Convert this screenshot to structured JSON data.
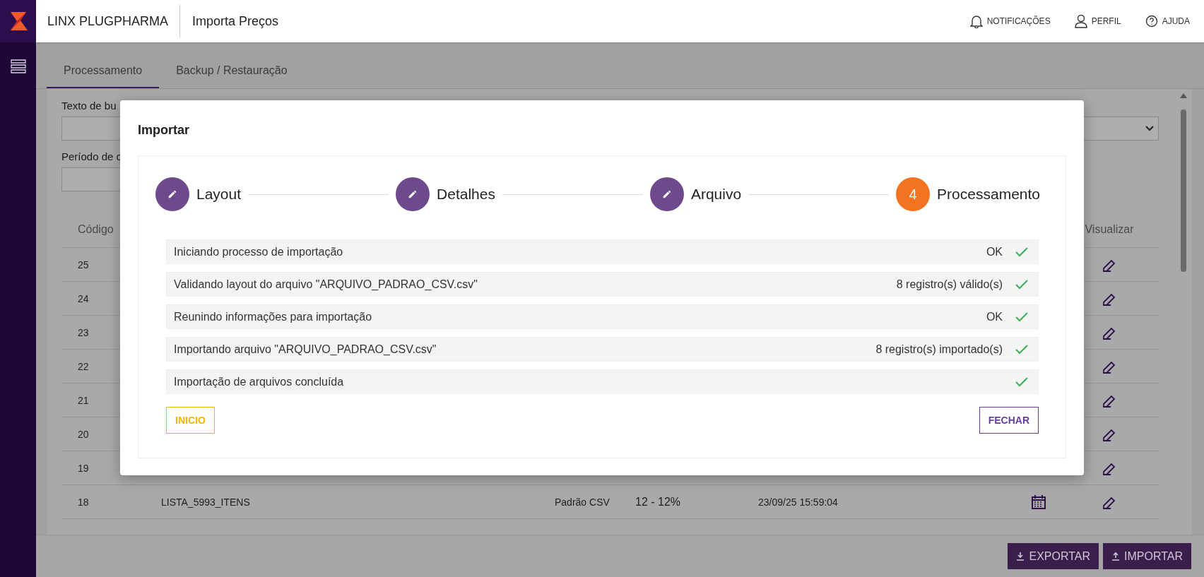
{
  "app": {
    "brand": "LINX PLUGPHARMA",
    "page_title": "Importa Preços"
  },
  "top_actions": [
    {
      "label": "NOTIFICAÇÕES",
      "kind": "bell"
    },
    {
      "label": "PERFIL",
      "kind": "user"
    },
    {
      "label": "AJUDA",
      "kind": "help"
    }
  ],
  "tabs": [
    {
      "label": "Processamento",
      "selected": true
    },
    {
      "label": "Backup / Restauração",
      "selected": false
    }
  ],
  "filters": {
    "search_label": "Texto de bu",
    "period_label": "Período de c"
  },
  "table": {
    "columns": {
      "code": "Código",
      "view": "Visualizar"
    },
    "rows": [
      {
        "code": "25"
      },
      {
        "code": "24"
      },
      {
        "code": "23"
      },
      {
        "code": "22"
      },
      {
        "code": "21"
      },
      {
        "code": "20"
      },
      {
        "code": "19"
      },
      {
        "code": "18",
        "name": "LISTA_5993_ITENS",
        "layout": "Padrão CSV",
        "percent": "12 - 12%",
        "date": "23/09/25 15:59:04"
      }
    ]
  },
  "footer_buttons": [
    {
      "label": "EXPORTAR",
      "kind": "export"
    },
    {
      "label": "IMPORTAR",
      "kind": "import"
    }
  ],
  "modal": {
    "title": "Importar",
    "steps": [
      {
        "label": "Layout",
        "done": true
      },
      {
        "label": "Detalhes",
        "done": true
      },
      {
        "label": "Arquivo",
        "done": true
      },
      {
        "label": "Processamento",
        "done": false,
        "number": "4"
      }
    ],
    "log": [
      {
        "message": "Iniciando processo de importação",
        "result": "OK",
        "ok": true
      },
      {
        "message": "Validando layout do arquivo \"ARQUIVO_PADRAO_CSV.csv\"",
        "result": "8 registro(s) válido(s)",
        "ok": true
      },
      {
        "message": "Reunindo informações para importação",
        "result": "OK",
        "ok": true
      },
      {
        "message": "Importando arquivo \"ARQUIVO_PADRAO_CSV.csv\"",
        "result": "8 registro(s) importado(s)",
        "ok": true
      },
      {
        "message": "Importação de arquivos concluída",
        "ok": true
      }
    ],
    "buttons": [
      {
        "label": "INICIO",
        "kind": "secondary"
      },
      {
        "label": "FECHAR",
        "kind": "primary"
      }
    ]
  }
}
